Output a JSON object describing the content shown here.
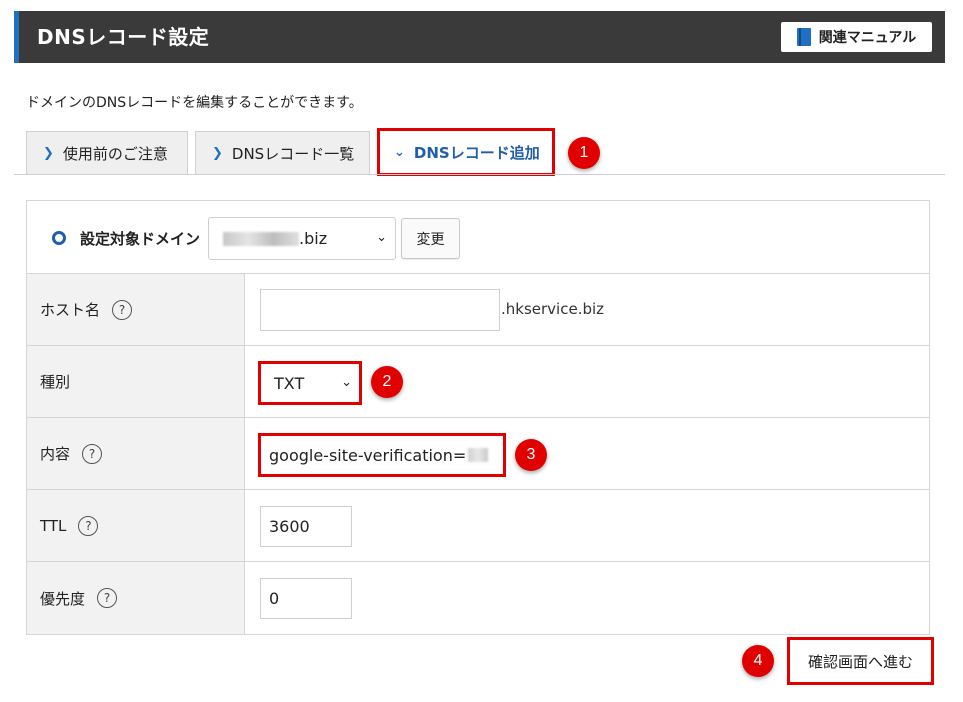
{
  "header": {
    "title": "DNSレコード設定",
    "manual_button": "関連マニュアル"
  },
  "description": "ドメインのDNSレコードを編集することができます。",
  "tabs": [
    {
      "label": "使用前のご注意",
      "active": false
    },
    {
      "label": "DNSレコード一覧",
      "active": false
    },
    {
      "label": "DNSレコード追加",
      "active": true
    }
  ],
  "callouts": [
    "1",
    "2",
    "3",
    "4"
  ],
  "domain": {
    "label": "設定対象ドメイン",
    "selected_suffix": ".biz",
    "change_button": "変更"
  },
  "form": {
    "host": {
      "label": "ホスト名",
      "value": "",
      "suffix": ".hkservice.biz"
    },
    "type": {
      "label": "種別",
      "selected": "TXT"
    },
    "content": {
      "label": "内容",
      "value": "google-site-verification="
    },
    "ttl": {
      "label": "TTL",
      "value": "3600"
    },
    "priority": {
      "label": "優先度",
      "value": "0"
    }
  },
  "help_glyph": "?",
  "confirm_button": "確認画面へ進む",
  "colors": {
    "header_bg": "#3a3a3a",
    "accent_blue": "#1f6fc2",
    "highlight_red": "#e10000",
    "label_bg": "#f2f2f2"
  }
}
